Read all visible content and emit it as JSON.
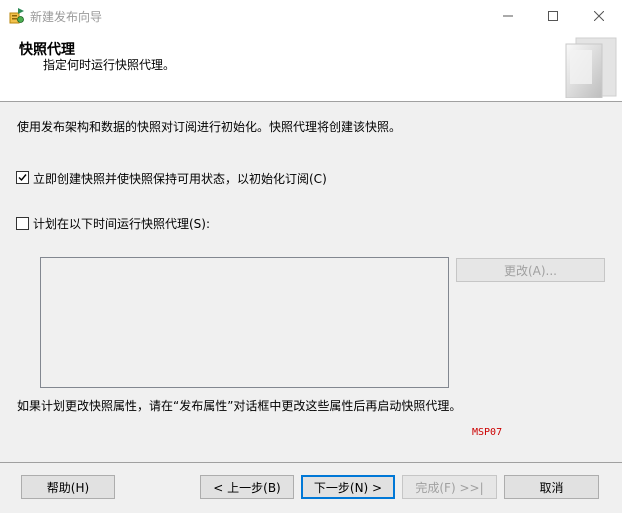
{
  "window": {
    "title": "新建发布向导",
    "app_icon": "wizard-icon",
    "controls": [
      "minimize-icon",
      "maximize-icon",
      "close-icon"
    ]
  },
  "header": {
    "title": "快照代理",
    "subtitle": "指定何时运行快照代理。",
    "graphic": "wizard-banner-graphic"
  },
  "body": {
    "description": "使用发布架构和数据的快照对订阅进行初始化。快照代理将创建该快照。",
    "create_now": {
      "label": "立即创建快照并使快照保持可用状态，以初始化订阅(C)",
      "checked": true
    },
    "schedule": {
      "label": "计划在以下时间运行快照代理(S):",
      "checked": false
    },
    "schedule_text": "",
    "change_button": "更改(A)...",
    "note": "如果计划更改快照属性，请在“发布属性”对话框中更改这些属性后再启动快照代理。",
    "code": "MSP07"
  },
  "footer": {
    "help": "帮助(H)",
    "back": "< 上一步(B)",
    "next": "下一步(N) >",
    "finish": "完成(F) >>|",
    "cancel": "取消"
  },
  "colors": {
    "background": "#f0f0f0",
    "header_background": "#ffffff",
    "focus_border": "#0078d7",
    "code_text": "#cc0000"
  }
}
